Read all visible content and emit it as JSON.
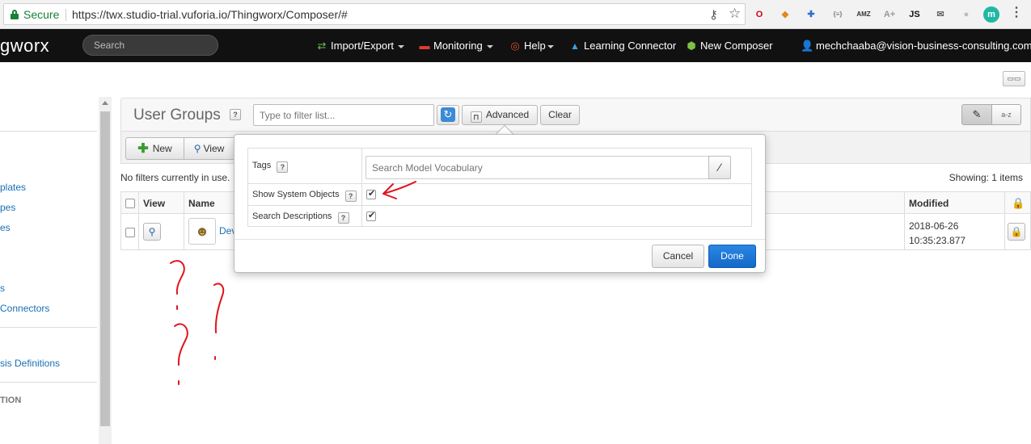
{
  "browser": {
    "secure_label": "Secure",
    "url": "https://twx.studio-trial.vuforia.io/Thingworx/Composer/#",
    "extensions": [
      {
        "name": "opera-icon",
        "glyph": "O",
        "color": "#d6001c"
      },
      {
        "name": "fox-extension-icon",
        "glyph": "◆",
        "color": "#e0891e"
      },
      {
        "name": "network-extension-icon",
        "glyph": "✚",
        "color": "#2a6fd6"
      },
      {
        "name": "json-extension-icon",
        "glyph": "{≡}",
        "color": "#777"
      },
      {
        "name": "amz-extension-icon",
        "glyph": "AMZ",
        "color": "#333"
      },
      {
        "name": "font-extension-icon",
        "glyph": "A+",
        "color": "#999"
      },
      {
        "name": "js-extension-icon",
        "glyph": "JS",
        "color": "#111"
      },
      {
        "name": "inbox-extension-icon",
        "glyph": "✉",
        "color": "#666"
      },
      {
        "name": "circle-extension-icon",
        "glyph": "●",
        "color": "#bbb"
      },
      {
        "name": "profile-m-icon",
        "glyph": "m",
        "color": "#1fb8a4"
      }
    ]
  },
  "nav": {
    "brand": "gworx",
    "search_placeholder": "Search",
    "items": [
      {
        "label": "Import/Export",
        "icon": "⇄",
        "icon_color": "#6fc04a"
      },
      {
        "label": "Monitoring",
        "icon": "▬",
        "icon_color": "#e03c31"
      },
      {
        "label": "Help",
        "icon": "◎",
        "icon_color": "#e04a2a"
      },
      {
        "label": "Learning Connector",
        "icon": "🎓",
        "icon_color": "#3a9ee6"
      },
      {
        "label": "New Composer",
        "icon": "⬢",
        "icon_color": "#7dc242"
      }
    ],
    "user": "mechchaaba@vision-business-consulting.com"
  },
  "sidebar": {
    "items": [
      {
        "label": "plates"
      },
      {
        "label": "pes"
      },
      {
        "label": "es"
      },
      {
        "label": "s"
      },
      {
        "label": " Connectors"
      },
      {
        "label": "sis Definitions"
      }
    ],
    "section": "TION"
  },
  "main": {
    "title": "User Groups",
    "help": "?",
    "filter_placeholder": "Type to filter list...",
    "advanced_label": "Advanced",
    "clear_label": "Clear",
    "new_label": "New",
    "view_label": "View",
    "no_filters": "No filters currently in use.",
    "showing": "Showing: 1 items",
    "columns": {
      "view": "View",
      "name": "Name",
      "modified": "Modified"
    },
    "rows": [
      {
        "name": "Dev",
        "modified_date": "2018-06-26",
        "modified_time": "10:35:23.877"
      }
    ]
  },
  "advanced_popup": {
    "tags_label": "Tags",
    "vocab_placeholder": "Search Model Vocabulary",
    "show_system_label": "Show System Objects",
    "show_system_checked": true,
    "search_desc_label": "Search Descriptions",
    "search_desc_checked": true,
    "cancel_label": "Cancel",
    "done_label": "Done"
  },
  "annotation_color": "#e0141e"
}
